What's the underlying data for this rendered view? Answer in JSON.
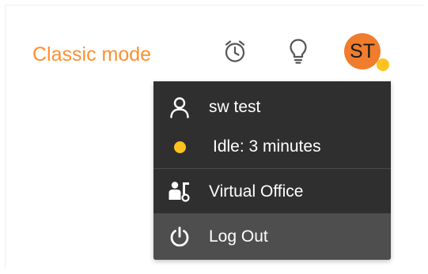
{
  "header": {
    "classic_mode_label": "Classic mode",
    "alarm_icon": "alarm-clock-icon",
    "bulb_icon": "lightbulb-icon",
    "avatar_initials": "ST",
    "avatar_color": "#f07d2d",
    "status_color": "#ffc21e",
    "accent_color": "#ff8f2f"
  },
  "user_menu": {
    "username": "sw test",
    "status_text": "Idle: 3 minutes",
    "items": [
      {
        "label": "Virtual Office",
        "icon": "virtual-office-icon"
      },
      {
        "label": "Log Out",
        "icon": "power-icon"
      }
    ]
  }
}
